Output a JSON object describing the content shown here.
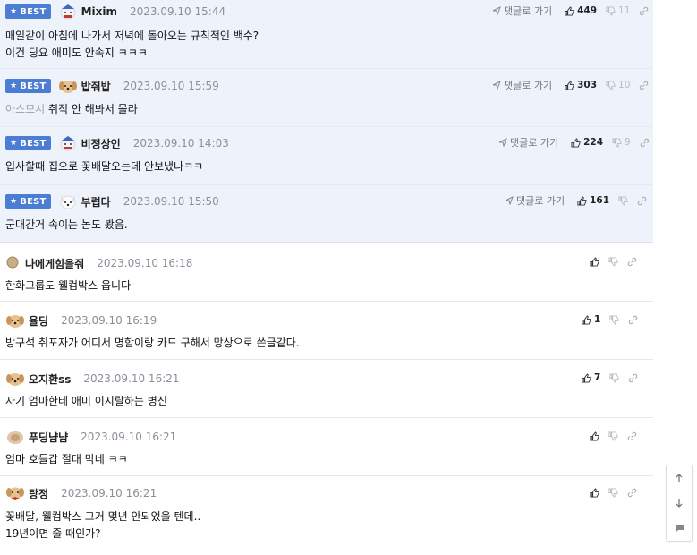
{
  "labels": {
    "best": "BEST",
    "reply": "댓글로 가기"
  },
  "comments": [
    {
      "best": true,
      "nick": "Mixim",
      "date": "2023.09.10 15:44",
      "avatar": "dog-santa-avatar",
      "lines": [
        "매일같이 아침에 나가서 저녁에 돌아오는 규칙적인 백수?",
        "이건 딩요 애미도 안속지 ㅋㅋㅋ"
      ],
      "up": "449",
      "down": "11"
    },
    {
      "best": true,
      "nick": "밥줘밥",
      "date": "2023.09.10 15:59",
      "avatar": "puppy-avatar",
      "quote": "아스모시",
      "lines": [
        "취직 안 해봐서 몰라"
      ],
      "up": "303",
      "down": "10"
    },
    {
      "best": true,
      "nick": "비정상인",
      "date": "2023.09.10 14:03",
      "avatar": "dog-santa-avatar",
      "lines": [
        "입사할때 집으로 꽃배달오는데 안보냈나ㅋㅋ"
      ],
      "up": "224",
      "down": "9"
    },
    {
      "best": true,
      "nick": "부럽다",
      "date": "2023.09.10 15:50",
      "avatar": "white-dog-avatar",
      "lines": [
        "군대간거 속이는 놈도 봤음."
      ],
      "up": "161",
      "down": ""
    },
    {
      "best": false,
      "nick": "나에게힘을줘",
      "date": "2023.09.10 16:18",
      "avatar": "dot-avatar",
      "lines": [
        "한화그룹도 웰컴박스 옵니다"
      ],
      "up": "",
      "down": ""
    },
    {
      "best": false,
      "nick": "율딩",
      "date": "2023.09.10 16:19",
      "avatar": "puppy-avatar",
      "lines": [
        "방구석 취포자가 어디서 명함이랑 카드 구해서 망상으로 쓴글같다."
      ],
      "up": "1",
      "down": ""
    },
    {
      "best": false,
      "nick": "오지환ss",
      "date": "2023.09.10 16:21",
      "avatar": "puppy-avatar",
      "lines": [
        "자기 엄마한테 애미 이지랄하는 병신"
      ],
      "up": "7",
      "down": ""
    },
    {
      "best": false,
      "nick": "푸딩냠냠",
      "date": "2023.09.10 16:21",
      "avatar": "blurred-avatar",
      "lines": [
        "엄마 호들갑 절대 막네 ㅋㅋ"
      ],
      "up": "",
      "down": ""
    },
    {
      "best": false,
      "nick": "탕정",
      "date": "2023.09.10 16:21",
      "avatar": "puppy-bow-avatar",
      "lines": [
        "꽃배달, 웰컴박스 그거 몇년 안되었을 텐데..",
        "19년이면 줄 때인가?"
      ],
      "up": "",
      "down": ""
    }
  ],
  "side_buttons": [
    "scroll-top-icon",
    "scroll-bottom-icon",
    "comment-icon"
  ],
  "colors": {
    "best_bg": "#eef3fb",
    "badge": "#4a7dd3",
    "date": "#8a8f99"
  }
}
